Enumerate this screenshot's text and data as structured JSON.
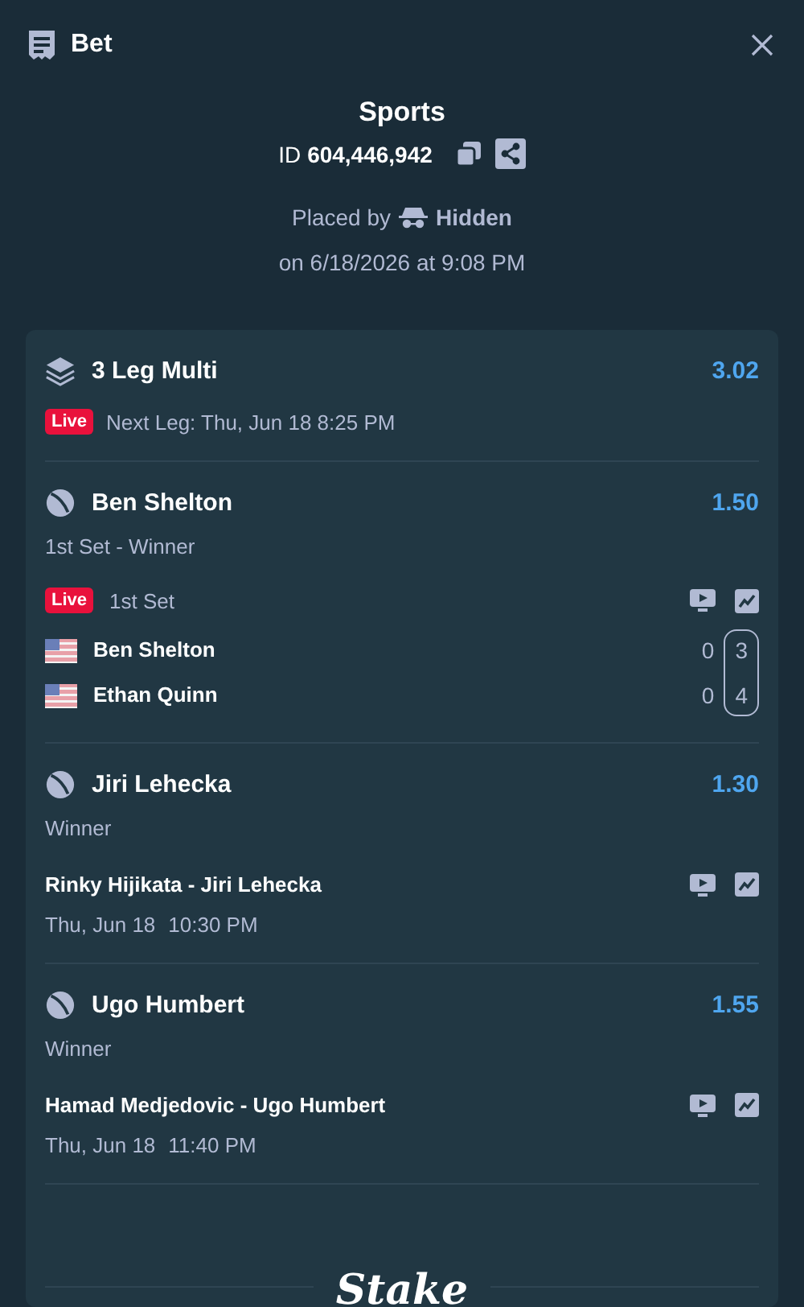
{
  "header": {
    "title": "Bet"
  },
  "bet": {
    "category": "Sports",
    "id_label": "ID",
    "id": "604,446,942",
    "placed_by_label": "Placed by",
    "user": "Hidden",
    "placed_on": "on 6/18/2026 at 9:08 PM"
  },
  "multi": {
    "title": "3 Leg Multi",
    "odds": "3.02",
    "live_badge": "Live",
    "next_leg": "Next Leg: Thu, Jun 18 8:25 PM"
  },
  "legs": [
    {
      "kind": "live",
      "selection": "Ben Shelton",
      "odds": "1.50",
      "market": "1st Set - Winner",
      "live_badge": "Live",
      "period": "1st Set",
      "players": [
        {
          "name": "Ben Shelton",
          "games": "0",
          "set": "3"
        },
        {
          "name": "Ethan Quinn",
          "games": "0",
          "set": "4"
        }
      ]
    },
    {
      "kind": "upcoming",
      "selection": "Jiri Lehecka",
      "odds": "1.30",
      "market": "Winner",
      "match": "Rinky Hijikata - Jiri Lehecka",
      "date": "Thu, Jun 18",
      "time": "10:30 PM"
    },
    {
      "kind": "upcoming",
      "selection": "Ugo Humbert",
      "odds": "1.55",
      "market": "Winner",
      "match": "Hamad Medjedovic - Ugo Humbert",
      "date": "Thu, Jun 18",
      "time": "11:40 PM"
    }
  ],
  "footer": {
    "brand": "Stake"
  }
}
